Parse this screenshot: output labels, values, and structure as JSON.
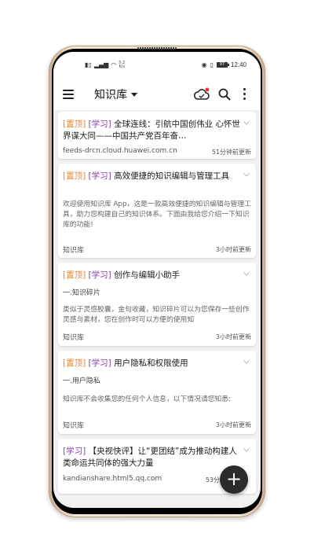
{
  "status_bar": {
    "network_speed_value": "5.2",
    "network_speed_unit": "K/s",
    "battery": "97",
    "time": "12:40"
  },
  "app_bar": {
    "title": "知识库",
    "icons": [
      "menu-icon",
      "cloud-sync-icon",
      "search-icon",
      "more-vert-icon"
    ],
    "cloud_badge_color": "#e53935"
  },
  "colors": {
    "tag_top": "#e8872a",
    "tag_study": "#8b3db8",
    "fab": "#2b2b2b"
  },
  "notes": [
    {
      "tag_top": "[置顶]",
      "tag_study": "[学习]",
      "title": "全球连线：引航中国创伟业 心怀世界谋大同——中国共产党百年奋…",
      "source": "feeds-drcn.cloud.huawei.com.cn",
      "time": "51分钟前更新"
    },
    {
      "tag_top": "[置顶]",
      "tag_study": "[学习]",
      "title": "高效便捷的知识编辑与管理工具",
      "snippet": "欢迎使用知识库 App，这是一款高效便捷的知识编辑与管理工具，助力您构建自己的知识体系。下面由我给您介绍一下知识库的功能!",
      "source": "知识库",
      "time": "3小时前更新"
    },
    {
      "tag_top": "[置顶]",
      "tag_study": "[学习]",
      "title": "创作与编辑小助手",
      "subtitle": "一.知识碎片",
      "snippet": "类似于灵感胶囊，金句收藏，知识碎片可以为您保存一些创作灵感与素材，您在创作时可以方便的使用知",
      "source": "知识库",
      "time": "3小时前更新"
    },
    {
      "tag_top": "[置顶]",
      "tag_study": "[学习]",
      "title": "用户隐私和权限使用",
      "subtitle": "一.用户隐私",
      "snippet": "知识库不会收集您的任何个人信息，以下情况请您知悉:",
      "source": "知识库",
      "time": "3小时前更新"
    },
    {
      "tag_study": "[学习]",
      "title": "【央视快评】让“更团结”成为推动构建人类命运共同体的强大力量",
      "source": "kandianshare.html5.qq.com",
      "time": "53分"
    }
  ],
  "fab": {
    "label": "+"
  }
}
